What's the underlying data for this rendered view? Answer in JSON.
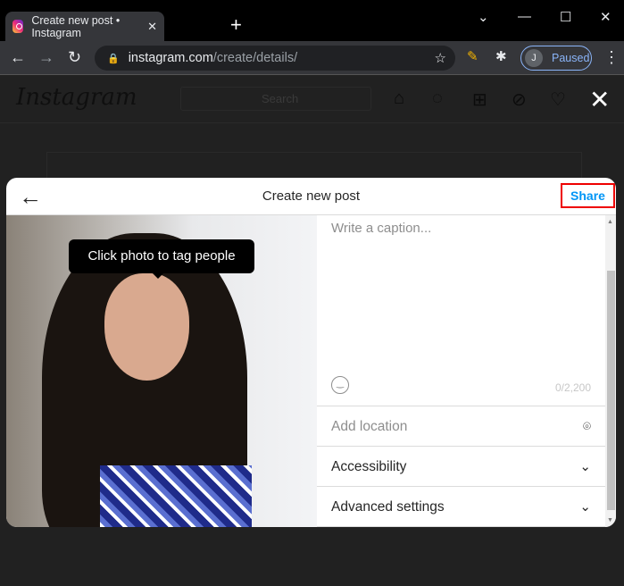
{
  "browser": {
    "tab_title": "Create new post • Instagram",
    "url_host": "instagram.com",
    "url_path": "/create/details/",
    "profile_initial": "J",
    "profile_status": "Paused"
  },
  "instagram": {
    "logo": "Instagram",
    "search_placeholder": "Search"
  },
  "modal": {
    "title": "Create new post",
    "share_label": "Share",
    "tooltip": "Click photo to tag people",
    "caption_placeholder": "Write a caption...",
    "char_count": "0/2,200",
    "location_placeholder": "Add location",
    "accessibility": "Accessibility",
    "advanced": "Advanced settings"
  }
}
